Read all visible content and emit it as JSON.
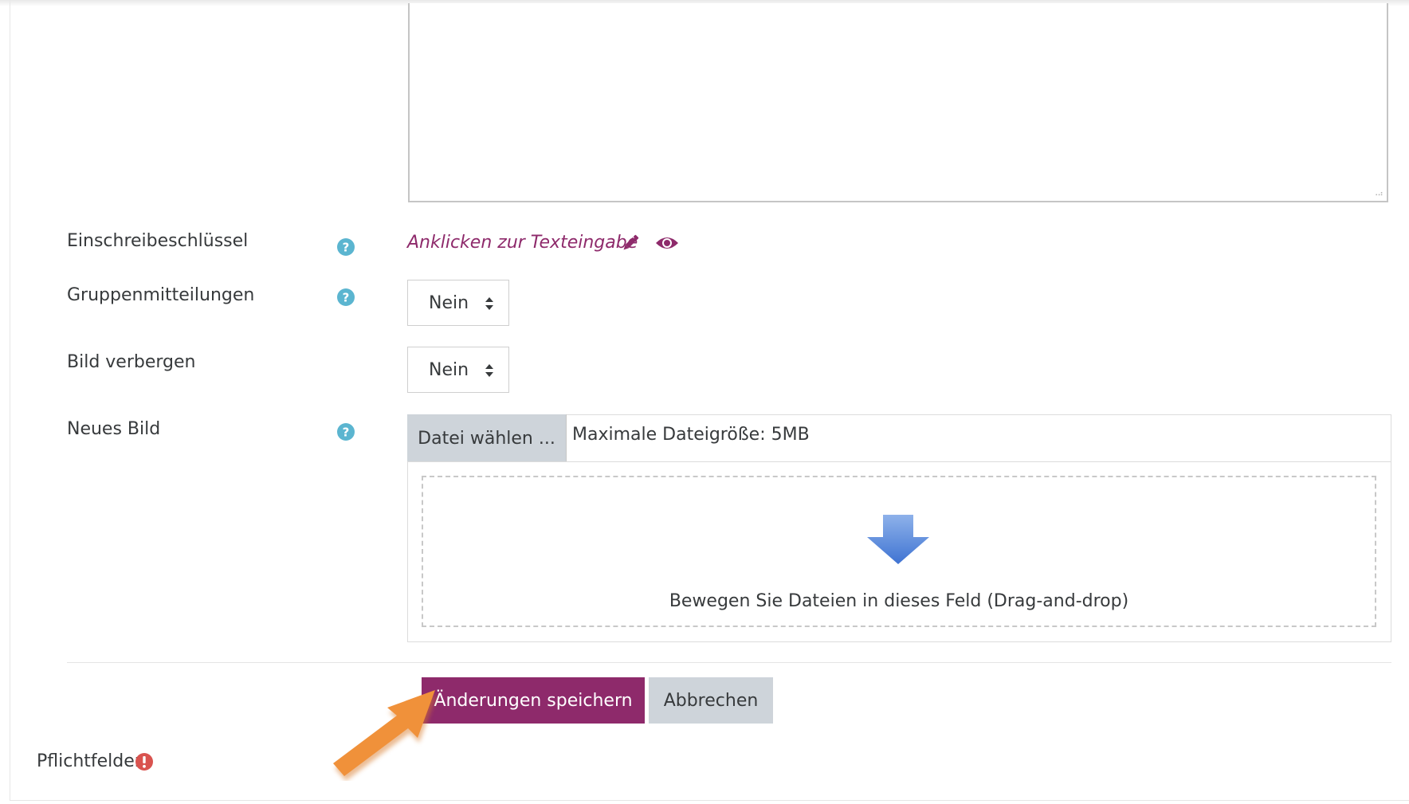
{
  "form": {
    "description_value": "",
    "fields": {
      "enrolment_key": {
        "label": "Einschreibeschlüssel",
        "inplace_text": "Anklicken zur Texteingabe"
      },
      "group_messaging": {
        "label": "Gruppenmitteilungen",
        "value": "Nein"
      },
      "hide_picture": {
        "label": "Bild verbergen",
        "value": "Nein"
      },
      "new_picture": {
        "label": "Neues Bild",
        "choose_label": "Datei wählen ...",
        "max_size": "Maximale Dateigröße: 5MB",
        "dropzone_text": "Bewegen Sie Dateien in dieses Feld (Drag-and-drop)"
      }
    },
    "actions": {
      "save_label": "Änderungen speichern",
      "cancel_label": "Abbrechen"
    },
    "required_note": "Pflichtfelder"
  },
  "colors": {
    "brand": "#8e2a6b",
    "help_icon": "#5bb5d0",
    "secondary_button": "#ced4da",
    "required_icon": "#d9534f",
    "annotation_arrow": "#f0913a"
  },
  "icons": {
    "help": "question-circle-icon",
    "edit": "pencil-icon",
    "reveal": "eye-icon",
    "select": "sort-arrows-icon",
    "drop": "down-arrow-icon",
    "required": "exclamation-circle-icon",
    "annotation": "pointer-arrow"
  }
}
